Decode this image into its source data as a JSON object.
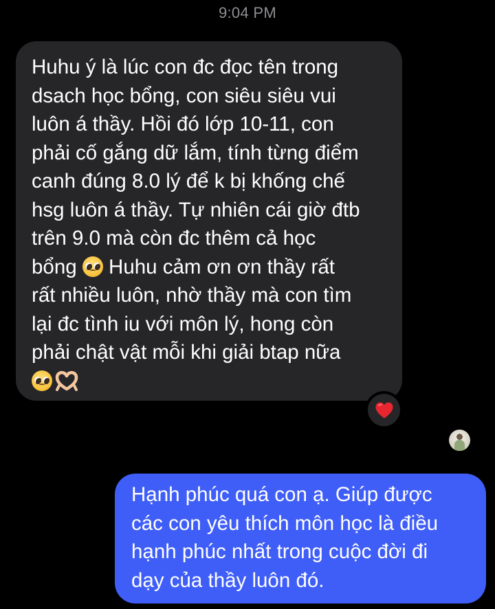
{
  "header": {
    "time": "9:04 PM"
  },
  "received_message": {
    "lines": [
      "Huhu ý là lúc con đc đọc tên trong",
      "dsach học bổng, con siêu siêu vui",
      "luôn á thầy. Hồi đó lớp 10-11, con",
      "phải cố gắng dữ lắm, tính từng điểm",
      "canh đúng 8.0 lý để k bị khống chế",
      "hsg luôn á thầy. Tự nhiên cái giờ đtb",
      "trên 9.0 mà còn đc thêm cả học",
      "bổng",
      "Huhu cảm ơn ơn thầy rất",
      "rất nhiều luôn, nhờ thầy mà con tìm",
      "lại đc tình iu với môn lý, hong còn",
      "phải chật vật mỗi khi giải btap nữa"
    ],
    "emojis": [
      "pleading-face-emoji",
      "heart-hands-emoji"
    ],
    "reaction": "red-heart-icon"
  },
  "sent_message": {
    "lines": [
      "Hạnh phúc quá con ạ. Giúp được",
      "các con yêu thích môn học là điều",
      "hạnh phúc nhất trong cuộc đời đi",
      "dạy của thầy luôn đó."
    ],
    "read_receipt": "avatar"
  },
  "colors": {
    "background": "#000000",
    "received_bubble": "#262629",
    "sent_bubble": "#3f5ef7",
    "timestamp": "#8e8e93",
    "reaction_heart": "#e8262f"
  }
}
